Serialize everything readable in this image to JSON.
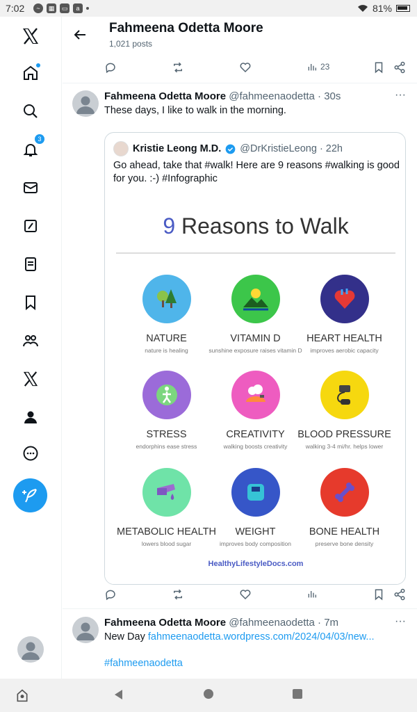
{
  "status": {
    "time": "7:02",
    "battery": "81%"
  },
  "header": {
    "name": "Fahmeena Odetta Moore",
    "posts": "1,021 posts"
  },
  "prev_actions": {
    "views": "23"
  },
  "tweet1": {
    "name": "Fahmeena Odetta Moore",
    "handle": "@fahmeenaodetta · 30s",
    "text": "These days, I like to walk in the morning.",
    "quote": {
      "name": "Kristie Leong M.D.",
      "handle": "@DrKristieLeong · 22h",
      "text": "Go ahead, take that #walk! Here are 9 reasons #walking is good for you. :-) #Infographic",
      "infographic": {
        "title_num": "9",
        "title_rest": " Reasons to Walk",
        "items": [
          {
            "label": "NATURE",
            "sub": "nature is healing",
            "color": "#4fb5ea"
          },
          {
            "label": "VITAMIN D",
            "sub": "sunshine exposure raises vitamin D",
            "color": "#3cc64a"
          },
          {
            "label": "HEART HEALTH",
            "sub": "improves aerobic capacity",
            "color": "#33308a"
          },
          {
            "label": "STRESS",
            "sub": "endorphins ease stress",
            "color": "#9b6bd9"
          },
          {
            "label": "CREATIVITY",
            "sub": "walking boosts creativity",
            "color": "#ee5cc0"
          },
          {
            "label": "BLOOD PRESSURE",
            "sub": "walking 3-4 mi/hr. helps lower",
            "color": "#f6d80f"
          },
          {
            "label": "METABOLIC HEALTH",
            "sub": "lowers blood sugar",
            "color": "#6fe3a8"
          },
          {
            "label": "WEIGHT",
            "sub": "improves body composition",
            "color": "#3656c8"
          },
          {
            "label": "BONE HEALTH",
            "sub": "preserve bone density",
            "color": "#e63a2c"
          }
        ],
        "footer": "HealthyLifestyleDocs.com"
      }
    }
  },
  "tweet2": {
    "name": "Fahmeena Odetta Moore",
    "handle": "@fahmeenaodetta · 7m",
    "text_prefix": "New Day ",
    "link": "fahmeenaodetta.wordpress.com/2024/04/03/new...",
    "hashtag": "#fahmeenaodetta"
  },
  "rail": {
    "notifications_count": "3"
  },
  "colors": {
    "accent": "#1d9bf0",
    "text": "#0f1419",
    "muted": "#536471"
  }
}
